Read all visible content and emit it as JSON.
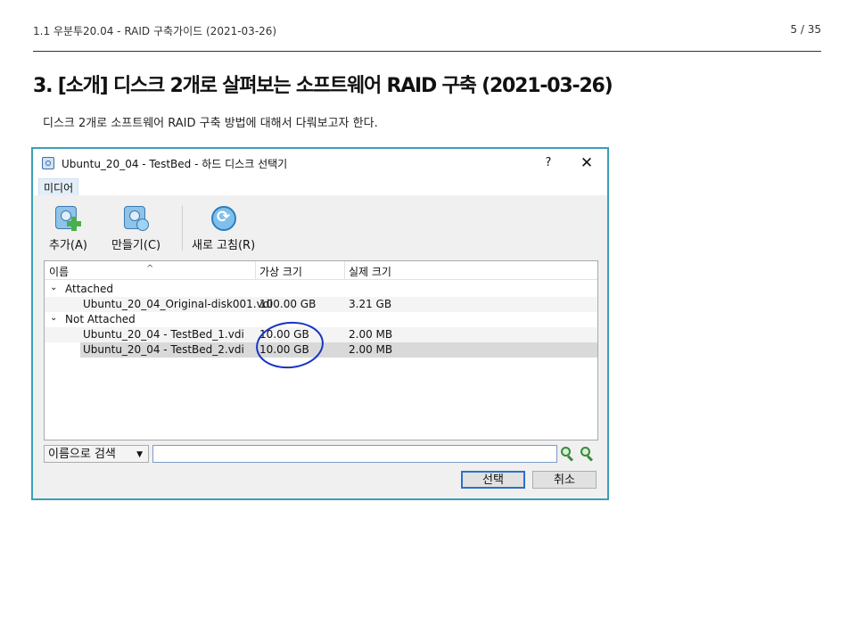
{
  "page": {
    "running_header": "1.1 우분투20.04 - RAID 구축가이드 (2021-03-26)",
    "page_number": "5 / 35",
    "section_title": "3. [소개] 디스크 2개로 살펴보는 소프트웨어 RAID 구축 (2021-03-26)",
    "intro_text": "디스크 2개로 소프트웨어 RAID 구축 방법에 대해서 다뤄보고자 한다."
  },
  "dialog": {
    "title": "Ubuntu_20_04 - TestBed - 하드 디스크 선택기",
    "help_label": "?",
    "close_label": "✕",
    "menu": [
      "미디어"
    ],
    "toolbar": [
      {
        "label": "추가(A)",
        "icon": "disk-add-icon"
      },
      {
        "label": "만들기(C)",
        "icon": "disk-create-icon"
      },
      {
        "label": "새로 고침(R)",
        "icon": "refresh-icon"
      }
    ],
    "columns": [
      "이름",
      "가상 크기",
      "실제 크기"
    ],
    "sort_indicator": "^",
    "groups": [
      {
        "name": "Attached",
        "items": [
          {
            "name": "Ubuntu_20_04_Original-disk001.vdi",
            "virtual_size": "100.00 GB",
            "actual_size": "3.21 GB"
          }
        ]
      },
      {
        "name": "Not Attached",
        "items": [
          {
            "name": "Ubuntu_20_04 - TestBed_1.vdi",
            "virtual_size": "10.00 GB",
            "actual_size": "2.00 MB"
          },
          {
            "name": "Ubuntu_20_04 - TestBed_2.vdi",
            "virtual_size": "10.00 GB",
            "actual_size": "2.00 MB"
          }
        ]
      }
    ],
    "search": {
      "mode": "이름으로 검색",
      "value": ""
    },
    "buttons": {
      "select": "선택",
      "cancel": "취소"
    },
    "annotation_color": "#1733c2",
    "border_color": "#3a9fb8"
  }
}
